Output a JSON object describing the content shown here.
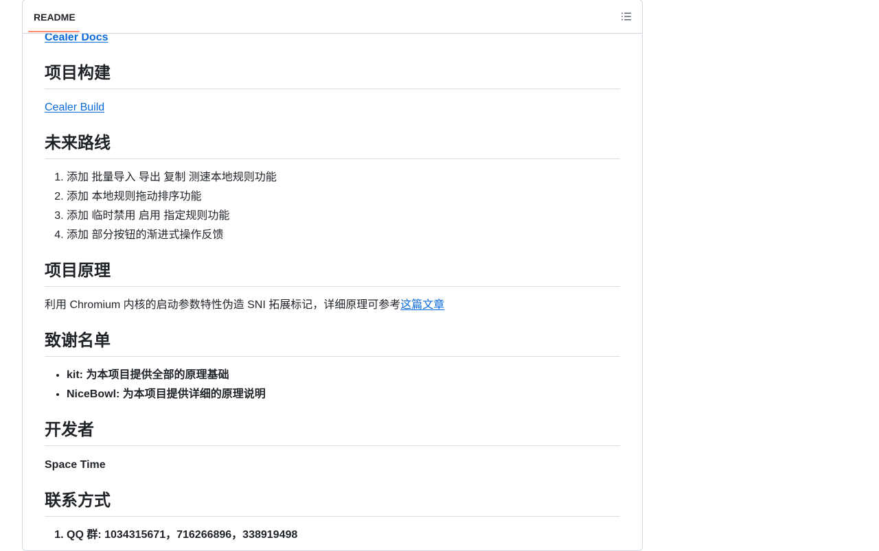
{
  "header": {
    "tab_label": "README",
    "outline_icon": "list-unordered-icon"
  },
  "content": {
    "docs_link": "Cealer Docs",
    "build": {
      "heading": "项目构建",
      "link": "Cealer Build"
    },
    "roadmap": {
      "heading": "未来路线",
      "items": [
        "添加 批量导入 导出 复制 测速本地规则功能",
        "添加 本地规则拖动排序功能",
        "添加 临时禁用 启用 指定规则功能",
        "添加 部分按钮的渐进式操作反馈"
      ]
    },
    "principle": {
      "heading": "项目原理",
      "text": "利用 Chromium 内核的启动参数特性伪造 SNI 拓展标记，详细原理可参考",
      "link": "这篇文章"
    },
    "thanks": {
      "heading": "致谢名单",
      "items": [
        "kit: 为本项目提供全部的原理基础",
        "NiceBowl: 为本项目提供详细的原理说明"
      ]
    },
    "developer": {
      "heading": "开发者",
      "name": "Space Time"
    },
    "contact": {
      "heading": "联系方式",
      "items": [
        "QQ 群: 1034315671，716266896，338919498"
      ]
    }
  },
  "colors": {
    "link": "#0969da",
    "tab_underline": "#fd8c73",
    "border": "#d0d7de",
    "text": "#1f2328"
  }
}
